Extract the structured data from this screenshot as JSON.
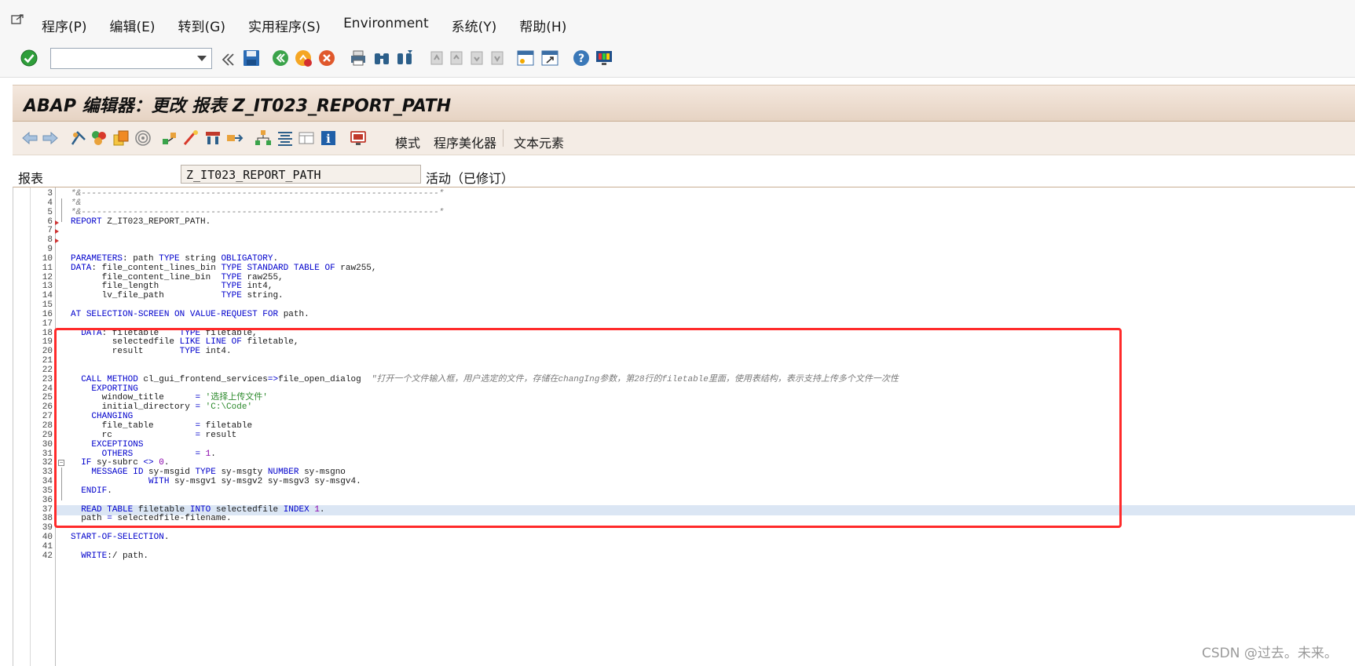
{
  "menu": {
    "items": [
      "程序(P)",
      "编辑(E)",
      "转到(G)",
      "实用程序(S)",
      "Environment",
      "系统(Y)",
      "帮助(H)"
    ]
  },
  "title": "ABAP 编辑器：更改 报表 Z_IT023_REPORT_PATH",
  "app_toolbar": {
    "buttons": [
      "模式",
      "程序美化器",
      "文本元素"
    ]
  },
  "report_field": {
    "label": "报表",
    "value": "Z_IT023_REPORT_PATH",
    "status": "活动（已修订）"
  },
  "code_lines": [
    {
      "n": "3",
      "text": "*&---------------------------------------------------------------------*"
    },
    {
      "n": "4",
      "text": "*&"
    },
    {
      "n": "5",
      "text": "*&---------------------------------------------------------------------*"
    },
    {
      "n": "6",
      "text": "REPORT Z_IT023_REPORT_PATH."
    },
    {
      "n": "7",
      "text": ""
    },
    {
      "n": "8",
      "text": ""
    },
    {
      "n": "9",
      "text": ""
    },
    {
      "n": "10",
      "text": "PARAMETERS: path TYPE string OBLIGATORY."
    },
    {
      "n": "11",
      "text": "DATA: file_content_lines_bin TYPE STANDARD TABLE OF raw255,"
    },
    {
      "n": "12",
      "text": "      file_content_line_bin  TYPE raw255,"
    },
    {
      "n": "13",
      "text": "      file_length            TYPE int4,"
    },
    {
      "n": "14",
      "text": "      lv_file_path           TYPE string."
    },
    {
      "n": "15",
      "text": ""
    },
    {
      "n": "16",
      "text": "AT SELECTION-SCREEN ON VALUE-REQUEST FOR path."
    },
    {
      "n": "17",
      "text": ""
    },
    {
      "n": "18",
      "text": "  DATA: filetable    TYPE filetable,"
    },
    {
      "n": "19",
      "text": "        selectedfile LIKE LINE OF filetable,"
    },
    {
      "n": "20",
      "text": "        result       TYPE int4."
    },
    {
      "n": "21",
      "text": ""
    },
    {
      "n": "22",
      "text": ""
    },
    {
      "n": "23",
      "text": "  CALL METHOD cl_gui_frontend_services=>file_open_dialog  \"打开一个文件输入框，用户选定的文件，存储在changIng参数，第28行的filetable里面，使用表结构，表示支持上传多个文件一次性"
    },
    {
      "n": "24",
      "text": "    EXPORTING"
    },
    {
      "n": "25",
      "text": "      window_title      = '选择上传文件'"
    },
    {
      "n": "26",
      "text": "      initial_directory = 'C:\\Code'"
    },
    {
      "n": "27",
      "text": "    CHANGING"
    },
    {
      "n": "28",
      "text": "      file_table        = filetable"
    },
    {
      "n": "29",
      "text": "      rc                = result"
    },
    {
      "n": "30",
      "text": "    EXCEPTIONS"
    },
    {
      "n": "31",
      "text": "      OTHERS            = 1."
    },
    {
      "n": "32",
      "text": "  IF sy-subrc <> 0."
    },
    {
      "n": "33",
      "text": "    MESSAGE ID sy-msgid TYPE sy-msgty NUMBER sy-msgno"
    },
    {
      "n": "34",
      "text": "               WITH sy-msgv1 sy-msgv2 sy-msgv3 sy-msgv4."
    },
    {
      "n": "35",
      "text": "  ENDIF."
    },
    {
      "n": "36",
      "text": ""
    },
    {
      "n": "37",
      "text": "  READ TABLE filetable INTO selectedfile INDEX 1."
    },
    {
      "n": "38",
      "text": "  path = selectedfile-filename."
    },
    {
      "n": "39",
      "text": ""
    },
    {
      "n": "40",
      "text": "START-OF-SELECTION."
    },
    {
      "n": "41",
      "text": ""
    },
    {
      "n": "42",
      "text": "  WRITE:/ path."
    }
  ],
  "highlighted_line": "37",
  "watermark": "CSDN @过去。未来。",
  "icons": {
    "toolbar": [
      "enter-check-icon",
      "back-icon",
      "save-icon",
      "exit-icon",
      "cancel-icon",
      "print-icon",
      "find-icon",
      "find-next-icon",
      "first-page-icon",
      "prev-page-icon",
      "next-page-icon",
      "last-page-icon",
      "new-session-icon",
      "shortcut-icon",
      "help-icon",
      "customize-layout-icon"
    ],
    "app": [
      "back-arrow-icon",
      "forward-arrow-icon",
      "other-object-icon",
      "check-icon",
      "activate-icon",
      "test-icon",
      "where-used-icon",
      "object-list-icon",
      "display-object-list-icon",
      "breakpoint-icon",
      "navigation-icon",
      "pattern-icon",
      "pretty-printer-icon",
      "hierarchy-icon",
      "insert-icon",
      "info-icon",
      "help-on-icon"
    ]
  },
  "colors": {
    "keyword": "#0000cc",
    "string": "#2e8b2e",
    "comment": "#7a7a7a",
    "annotation_box": "#ff2a2a",
    "title_bar": "#e6d3c3"
  }
}
